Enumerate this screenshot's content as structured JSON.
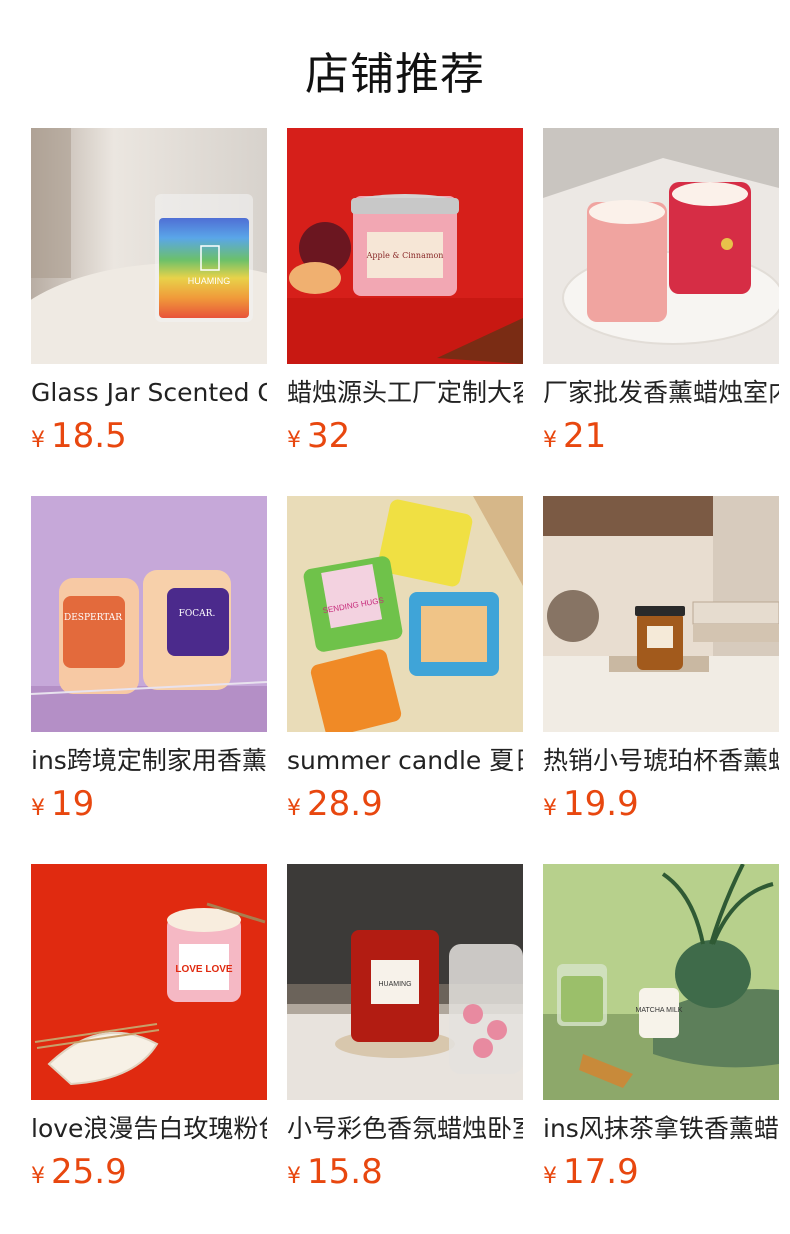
{
  "page": {
    "title": "店铺推荐"
  },
  "currency_symbol": "¥",
  "products": [
    {
      "name": "Glass Jar Scented Candle",
      "price": "18.5",
      "image": "rainbow-candle-image",
      "label": "HUAMING"
    },
    {
      "name": "蜡烛源头工厂定制大容量",
      "price": "32",
      "image": "apple-cinnamon-candle-image",
      "label": "Apple & Cinnamon"
    },
    {
      "name": "厂家批发香薰蜡烛室内",
      "price": "21",
      "image": "pink-red-candles-image"
    },
    {
      "name": "ins跨境定制家用香薰蜡烛",
      "price": "19",
      "image": "twin-jar-candles-image",
      "label_left": "DESPERTAR",
      "label_right": "FOCAR."
    },
    {
      "name": "summer candle 夏日",
      "price": "28.9",
      "image": "summer-candles-image",
      "label": "SENDING HUGS"
    },
    {
      "name": "热销小号琥珀杯香薰蜡烛",
      "price": "19.9",
      "image": "amber-candle-image"
    },
    {
      "name": "love浪漫告白玫瑰粉色",
      "price": "25.9",
      "image": "love-candle-image",
      "label": "LOVE LOVE"
    },
    {
      "name": "小号彩色香氛蜡烛卧室",
      "price": "15.8",
      "image": "red-glass-candle-image",
      "label": "HUAMING"
    },
    {
      "name": "ins风抹茶拿铁香薰蜡烛",
      "price": "17.9",
      "image": "matcha-candle-image",
      "label": "MATCHA MILK"
    }
  ],
  "colors": {
    "price": "#e8470f",
    "title": "#111111"
  }
}
